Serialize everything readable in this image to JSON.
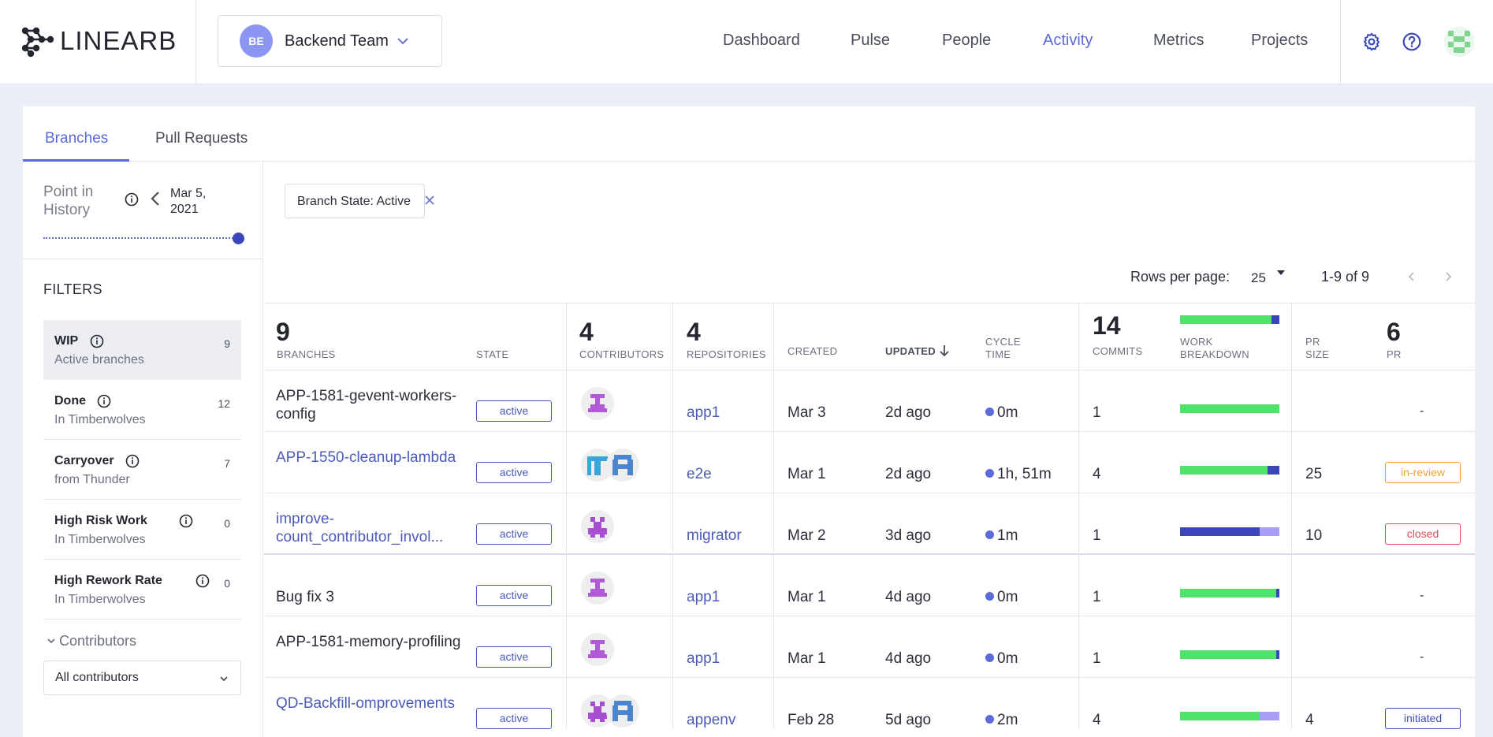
{
  "app": {
    "logo_text": "LINEARB"
  },
  "team": {
    "initials": "BE",
    "name": "Backend Team"
  },
  "nav": [
    {
      "label": "Dashboard",
      "active": false
    },
    {
      "label": "Pulse",
      "active": false
    },
    {
      "label": "People",
      "active": false
    },
    {
      "label": "Activity",
      "active": true
    },
    {
      "label": "Metrics",
      "active": false
    },
    {
      "label": "Projects",
      "active": false
    }
  ],
  "icons": {
    "settings": "gear-icon",
    "help": "question-icon",
    "user": "user-avatar"
  },
  "tabs": [
    {
      "label": "Branches",
      "active": true
    },
    {
      "label": "Pull Requests",
      "active": false
    }
  ],
  "history": {
    "label": "Point in History",
    "date": "Mar 5, 2021",
    "slider_position": 1.0
  },
  "filters": {
    "title": "FILTERS",
    "items": [
      {
        "name": "WIP",
        "sub": "Active branches",
        "count": "9",
        "active": true
      },
      {
        "name": "Done",
        "sub": "In Timberwolves",
        "count": "12",
        "active": false
      },
      {
        "name": "Carryover",
        "sub": "from Thunder",
        "count": "7",
        "active": false
      },
      {
        "name": "High Risk Work",
        "sub": "In Timberwolves",
        "count": "0",
        "active": false
      },
      {
        "name": "High Rework Rate",
        "sub": "In Timberwolves",
        "count": "0",
        "active": false
      }
    ]
  },
  "contributors": {
    "title": "Contributors",
    "selected": "All contributors"
  },
  "chip": {
    "label": "Branch State: Active"
  },
  "pagination": {
    "rows_label": "Rows per page:",
    "rows_value": "25",
    "range": "1-9 of 9"
  },
  "table": {
    "headers": {
      "branches_count": "9",
      "branches_label": "BRANCHES",
      "state_label": "STATE",
      "contributors_count": "4",
      "contributors_label": "CONTRIBUTORS",
      "repositories_count": "4",
      "repositories_label": "REPOSITORIES",
      "created_label": "CREATED",
      "updated_label": "UPDATED",
      "cycle_label_1": "CYCLE",
      "cycle_label_2": "TIME",
      "commits_count": "14",
      "commits_label": "COMMITS",
      "wb_label_1": "WORK",
      "wb_label_2": "BREAKDOWN",
      "prsize_label_1": "PR",
      "prsize_label_2": "SIZE",
      "pr_count": "6",
      "pr_label": "PR"
    },
    "rows": [
      {
        "branch": "APP-1581-gevent-workers-config",
        "link": false,
        "state": "active",
        "repo": "app1",
        "created": "Mar 3",
        "updated": "2d ago",
        "cycle": "0m",
        "commits": "1",
        "wb": [
          0.0,
          1.0,
          0.0
        ],
        "pr_size": "",
        "pr": "-",
        "pr_status": ""
      },
      {
        "branch": "APP-1550-cleanup-lambda",
        "link": true,
        "state": "active",
        "repo": "e2e",
        "created": "Mar 1",
        "updated": "2d ago",
        "cycle": "1h, 51m",
        "commits": "4",
        "wb": [
          0.0,
          0.88,
          0.12
        ],
        "pr_size": "25",
        "pr": "in-review",
        "pr_status": "in-review"
      },
      {
        "branch": "improve-count_contributor_invol...",
        "link": true,
        "state": "active",
        "repo": "migrator",
        "created": "Mar 2",
        "updated": "3d ago",
        "cycle": "1m",
        "commits": "1",
        "wb": [
          0.2,
          0.0,
          0.8
        ],
        "pr_size": "10",
        "pr": "closed",
        "pr_status": "closed"
      },
      {
        "branch": "Bug fix 3",
        "link": false,
        "state": "active",
        "repo": "app1",
        "created": "Mar 1",
        "updated": "4d ago",
        "cycle": "0m",
        "commits": "1",
        "wb": [
          0.0,
          0.97,
          0.03
        ],
        "pr_size": "",
        "pr": "-",
        "pr_status": ""
      },
      {
        "branch": "APP-1581-memory-profiling",
        "link": false,
        "state": "active",
        "repo": "app1",
        "created": "Mar 1",
        "updated": "4d ago",
        "cycle": "0m",
        "commits": "1",
        "wb": [
          0.0,
          0.97,
          0.03
        ],
        "pr_size": "",
        "pr": "-",
        "pr_status": ""
      },
      {
        "branch": "QD-Backfill-omprovements",
        "link": true,
        "state": "active",
        "repo": "appenv",
        "created": "Feb 28",
        "updated": "5d ago",
        "cycle": "2m",
        "commits": "4",
        "wb": [
          0.2,
          0.8,
          0.0
        ],
        "pr_size": "4",
        "pr": "initiated",
        "pr_status": "initiated"
      }
    ]
  },
  "colors": {
    "accent": "#5b6ad8",
    "green": "#4fe36a",
    "blue": "#3b46b8",
    "lavender": "#a79ef5",
    "inreview": "#f0a13a",
    "closed": "#e5485a",
    "initiated": "#3f4fb5"
  }
}
